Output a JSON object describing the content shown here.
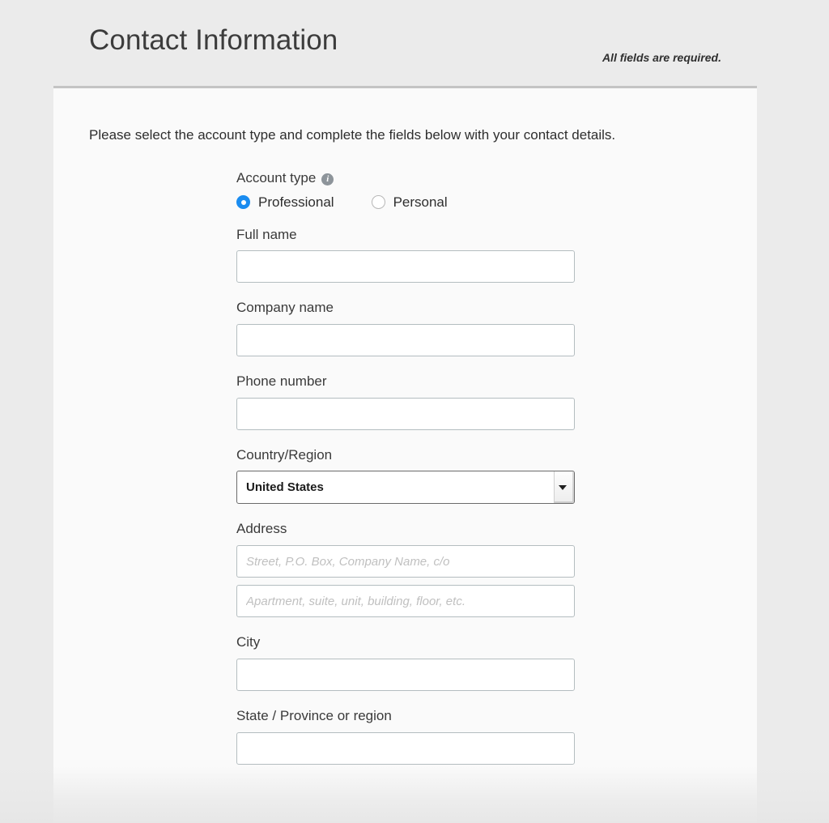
{
  "header": {
    "title": "Contact Information",
    "required_note": "All fields are required."
  },
  "card": {
    "intro": "Please select the account type and complete the fields below with your contact details."
  },
  "form": {
    "account_type": {
      "label": "Account type",
      "info_icon": "info-icon",
      "info_glyph": "i",
      "options": [
        {
          "label": "Professional",
          "selected": true
        },
        {
          "label": "Personal",
          "selected": false
        }
      ]
    },
    "fields": [
      {
        "label": "Full name",
        "value": "",
        "placeholder": ""
      },
      {
        "label": "Company name",
        "value": "",
        "placeholder": ""
      },
      {
        "label": "Phone number",
        "value": "",
        "placeholder": ""
      }
    ],
    "country": {
      "label": "Country/Region",
      "selected": "United States",
      "arrow_icon": "chevron-down-icon"
    },
    "address": {
      "label": "Address",
      "line1_placeholder": "Street, P.O. Box, Company Name, c/o",
      "line1_value": "",
      "line2_placeholder": "Apartment, suite, unit, building, floor, etc.",
      "line2_value": ""
    },
    "city": {
      "label": "City",
      "value": "",
      "placeholder": ""
    },
    "state": {
      "label": "State / Province or region",
      "value": "",
      "placeholder": ""
    }
  },
  "colors": {
    "page_background": "#ebebeb",
    "card_background": "#fafafa",
    "card_top_border": "#c4c4c4",
    "radio_accent": "#1a8cf0",
    "info_icon": "#8d949a",
    "input_border": "#b4bdc0",
    "select_border": "#6b6b6b",
    "placeholder_text": "#c0c0c0",
    "label_text": "#3a3a3a"
  }
}
